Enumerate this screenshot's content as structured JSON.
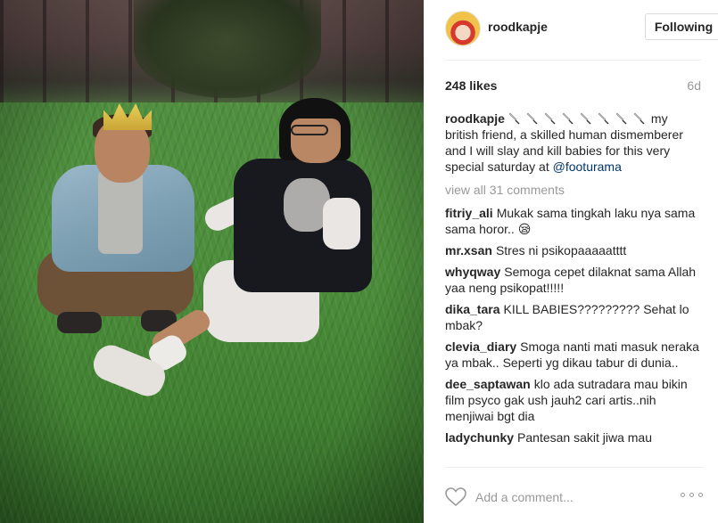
{
  "post": {
    "username": "roodkapje",
    "follow_label": "Following",
    "likes": "248 likes",
    "age": "6d",
    "caption": {
      "username": "roodkapje",
      "emoji_icon": "knife-icon",
      "emoji_count": 8,
      "text": "my british friend, a skilled human dismemberer and I will slay and kill babies for this very special saturday at ",
      "mention": "@footurama"
    },
    "view_all": "view all 31 comments",
    "comments": [
      {
        "username": "fitriy_ali",
        "text": "Mukak sama tingkah laku nya sama sama horor..",
        "emoji": "😪"
      },
      {
        "username": "mr.xsan",
        "text": "Stres ni psikopaaaaatttt"
      },
      {
        "username": "whyqway",
        "text": "Semoga cepet dilaknat sama Allah yaa neng psikopat!!!!!"
      },
      {
        "username": "dika_tara",
        "text": "KILL BABIES????????? Sehat lo mbak?"
      },
      {
        "username": "clevia_diary",
        "text": "Smoga nanti mati masuk neraka ya mbak.. Seperti yg dikau tabur di dunia.."
      },
      {
        "username": "dee_saptawan",
        "text": "klo ada sutradara mau bikin film psyco gak ush jauh2 cari artis..nih menjiwai bgt dia"
      },
      {
        "username": "ladychunky",
        "text": "Pantesan sakit jiwa mau"
      }
    ],
    "add_comment_placeholder": "Add a comment...",
    "icons": {
      "like": "heart-icon",
      "more": "more-options-icon"
    }
  }
}
